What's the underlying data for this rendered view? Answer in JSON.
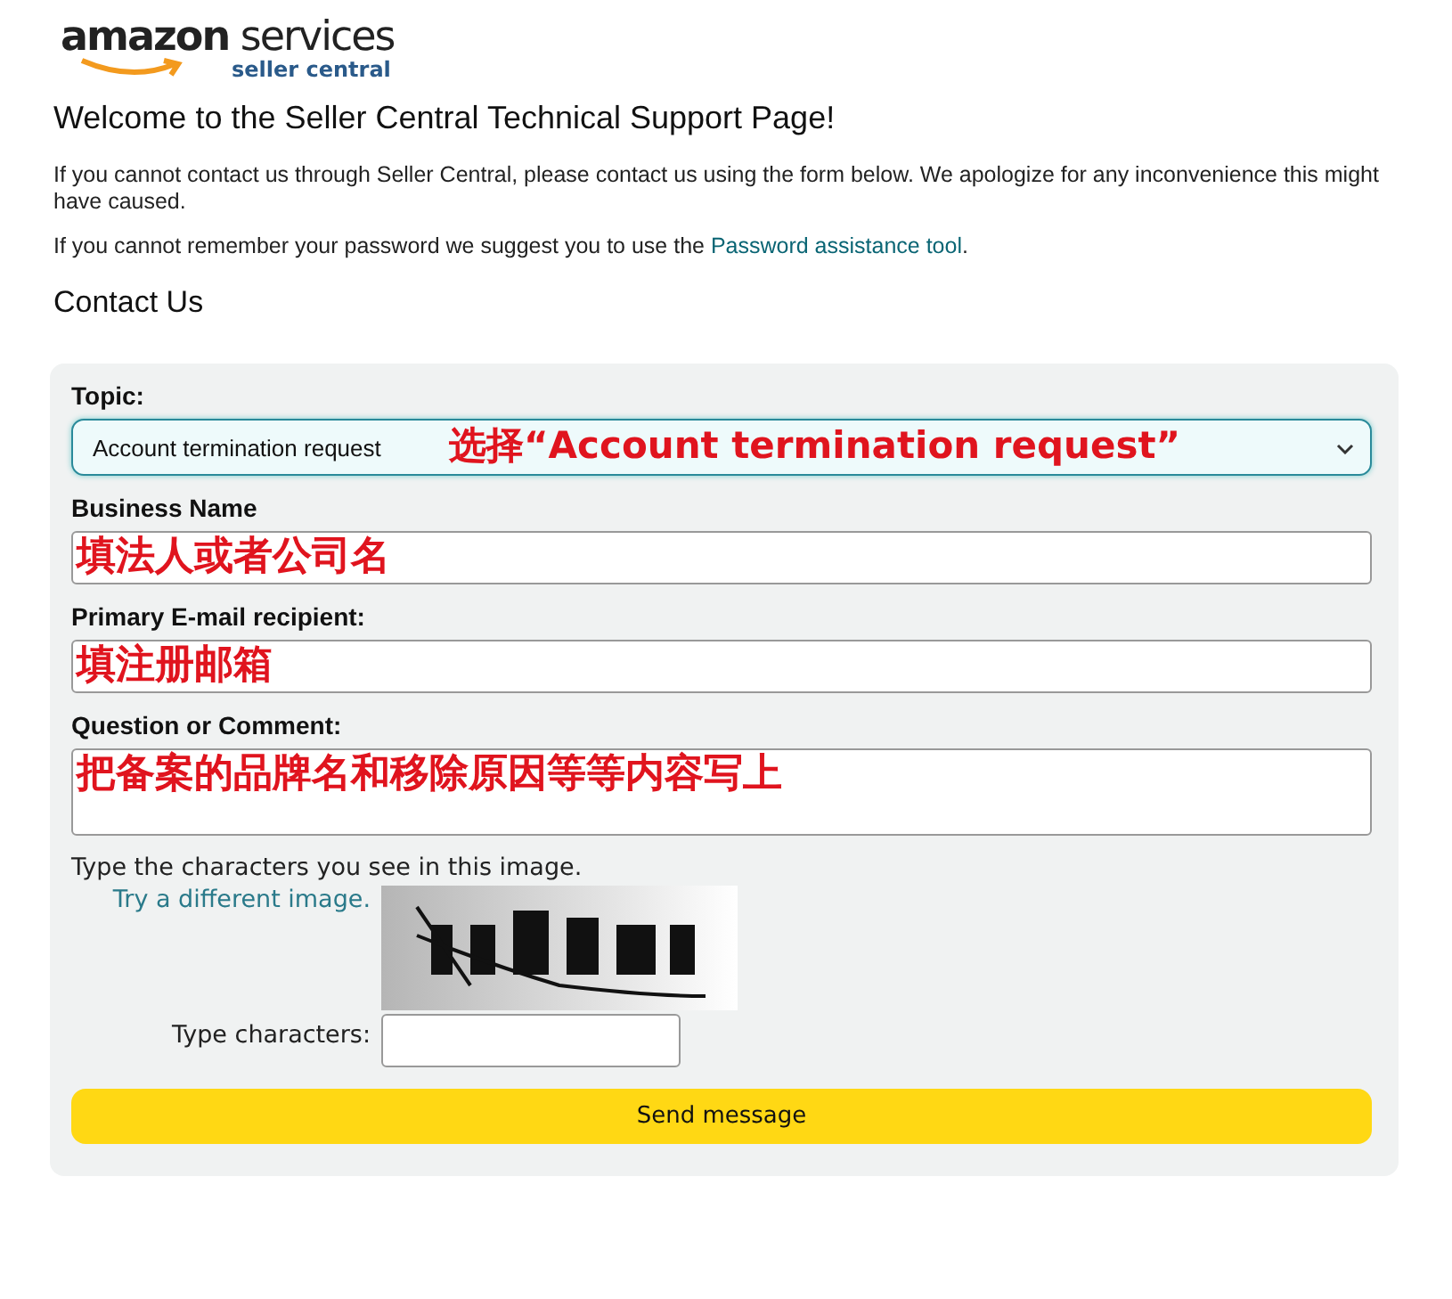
{
  "logo": {
    "brand": "amazon",
    "product": "services",
    "sub": "seller central"
  },
  "title": "Welcome to the Seller Central Technical Support Page!",
  "intro": "If you cannot contact us through Seller Central, please contact us using the form below. We apologize for any inconvenience this might have caused.",
  "password_note": {
    "text": "If you cannot remember your password we suggest you to use the ",
    "link": "Password assistance tool",
    "after": "."
  },
  "section": "Contact Us",
  "form": {
    "fields": [
      {
        "kind": "select",
        "label": "Topic:",
        "value": "Account termination request",
        "annotation": "选择“Account termination request”"
      },
      {
        "kind": "input",
        "label": "Business Name",
        "annotation": "填法人或者公司名"
      },
      {
        "kind": "input",
        "label": "Primary E-mail recipient:",
        "annotation": "填注册邮箱"
      },
      {
        "kind": "textarea",
        "label": "Question or Comment:",
        "annotation": "把备案的品牌名和移除原因等等内容写上"
      }
    ],
    "captcha": {
      "prompt": "Type the characters you see in this image.",
      "refresh_link": "Try a different image.",
      "input_label": "Type characters:"
    },
    "submit": "Send message"
  }
}
